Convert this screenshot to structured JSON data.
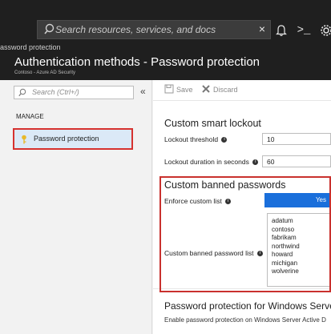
{
  "topbar": {
    "search_placeholder": "Search resources, services, and docs",
    "close_glyph": "×",
    "bell_icon": "bell-icon",
    "shell_icon": "cloud-shell-icon",
    "settings_icon": "gear-icon",
    "shell_glyph": ">_"
  },
  "breadcrumb": "assword protection",
  "header": {
    "title": "Authentication methods - Password protection",
    "subtitle": "Contoso - Azure AD Security"
  },
  "sidebar": {
    "search_placeholder": "Search (Ctrl+/)",
    "collapse_glyph": "«",
    "section_label": "MANAGE",
    "items": [
      {
        "label": "Password protection",
        "icon": "key-icon"
      }
    ]
  },
  "toolbar": {
    "save_label": "Save",
    "discard_label": "Discard"
  },
  "smart_lockout": {
    "title": "Custom smart lockout",
    "threshold_label": "Lockout threshold",
    "threshold_value": "10",
    "duration_label": "Lockout duration in seconds",
    "duration_value": "60"
  },
  "banned_passwords": {
    "title": "Custom banned passwords",
    "enforce_label": "Enforce custom list",
    "enforce_value": "Yes",
    "list_label": "Custom banned password list",
    "items": [
      "adatum",
      "contoso",
      "fabrikam",
      "northwind",
      "howard",
      "michigan",
      "wolverine"
    ]
  },
  "windows_server": {
    "title": "Password protection for Windows Server A",
    "description": "Enable password protection on Windows Server Active D"
  },
  "colors": {
    "topbar": "#1f1f1f",
    "highlight_border": "#c9312e",
    "toggle_on": "#1a6fdb",
    "nav_selected": "#dbe9f7"
  }
}
